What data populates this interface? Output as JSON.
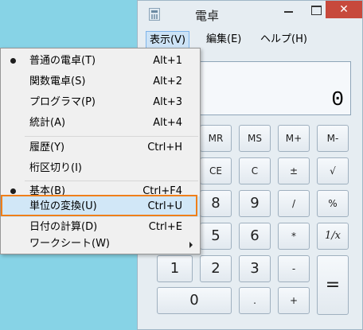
{
  "window": {
    "title": "電卓",
    "close_glyph": "✕"
  },
  "menubar": {
    "view": "表示(V)",
    "edit": "編集(E)",
    "help": "ヘルプ(H)"
  },
  "display": {
    "value": "0"
  },
  "keypad": {
    "r1": [
      "MR",
      "MS",
      "M+",
      "M-"
    ],
    "r2": [
      "CE",
      "C",
      "±",
      "√"
    ],
    "r3": [
      "8",
      "9",
      "/",
      "%"
    ],
    "r4": [
      "5",
      "6",
      "*",
      "1/x"
    ],
    "r5": [
      "1",
      "2",
      "3",
      "-",
      "="
    ],
    "r6": [
      "0",
      ".",
      "+"
    ]
  },
  "view_menu": {
    "items": [
      {
        "label": "普通の電卓(T)",
        "accel": "Alt+1"
      },
      {
        "label": "関数電卓(S)",
        "accel": "Alt+2"
      },
      {
        "label": "プログラマ(P)",
        "accel": "Alt+3"
      },
      {
        "label": "統計(A)",
        "accel": "Alt+4"
      },
      {
        "label": "履歴(Y)",
        "accel": "Ctrl+H"
      },
      {
        "label": "桁区切り(I)",
        "accel": ""
      },
      {
        "label": "基本(B)",
        "accel": "Ctrl+F4"
      },
      {
        "label": "単位の変換(U)",
        "accel": "Ctrl+U"
      },
      {
        "label": "日付の計算(D)",
        "accel": "Ctrl+E"
      },
      {
        "label": "ワークシート(W)",
        "accel": ""
      }
    ]
  },
  "colors": {
    "desktop": "#87d3e6",
    "highlight_box": "#ef7f1a",
    "close_button": "#c7493c"
  }
}
